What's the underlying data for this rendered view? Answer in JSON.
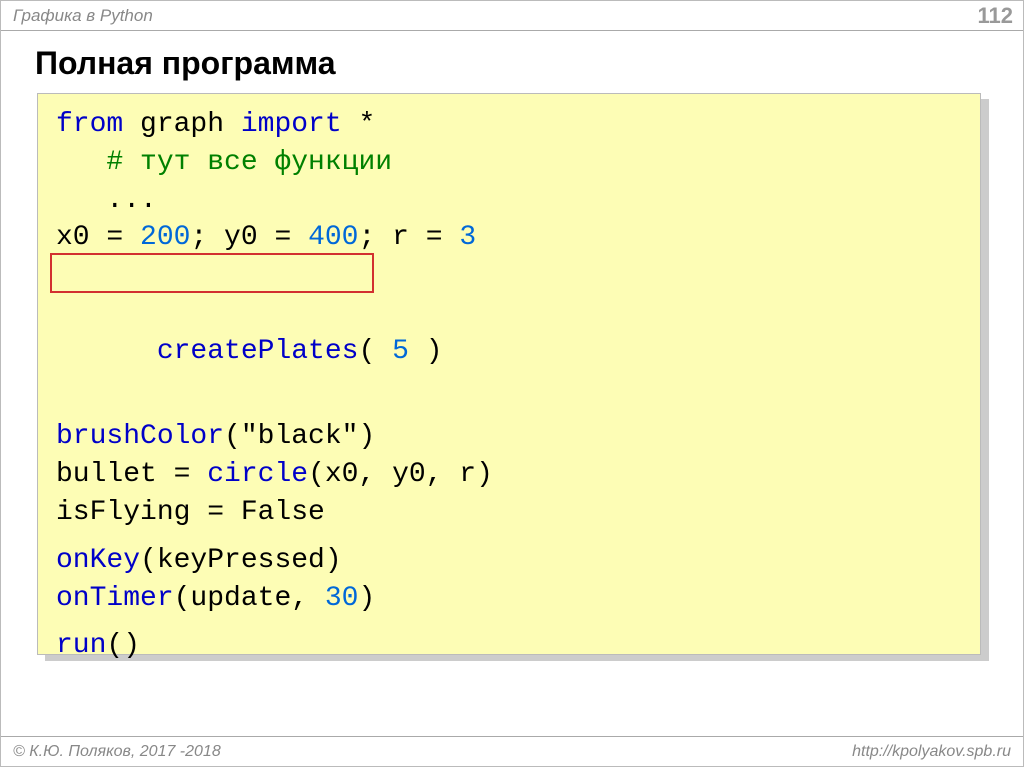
{
  "header": {
    "section": "Графика в Python",
    "page": "112"
  },
  "title": "Полная программа",
  "code": {
    "l1_from": "from",
    "l1_graph": " graph ",
    "l1_import": "import",
    "l1_star": " *",
    "l2_comment": "   # тут все функции",
    "l3_dots": "   ...",
    "l4_a": "x0 = ",
    "l4_n1": "200",
    "l4_b": "; y0 = ",
    "l4_n2": "400",
    "l4_c": "; r = ",
    "l4_n3": "3",
    "l5_fn": "createPlates",
    "l5_a": "( ",
    "l5_n": "5",
    "l5_b": " )",
    "l6_fn": "brushColor",
    "l6_a": "(\"black\")",
    "l7_a": "bullet",
    "l7_b": " = ",
    "l7_fn": "circle",
    "l7_c": "(x0, y0, r)",
    "l8_a": "isFlying = False",
    "l9_fn": "onKey",
    "l9_a": "(keyPressed)",
    "l10_fn": "onTimer",
    "l10_a": "(update, ",
    "l10_n": "30",
    "l10_b": ")",
    "l11_fn": "run",
    "l11_a": "()"
  },
  "footer": {
    "left": "© К.Ю. Поляков, 2017 -2018",
    "right": "http://kpolyakov.spb.ru"
  }
}
